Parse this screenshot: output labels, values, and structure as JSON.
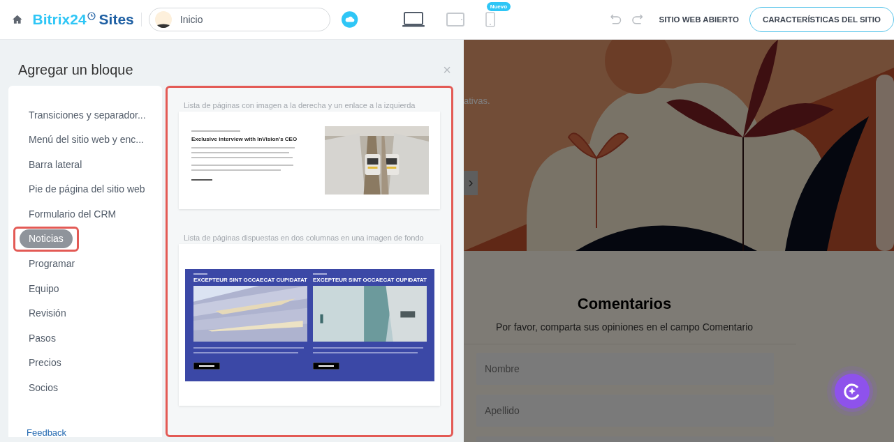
{
  "header": {
    "logo_main": "Bitrix24",
    "logo_sub": "Sites",
    "page_selector": {
      "value": "Inicio"
    },
    "devices": [
      {
        "kind": "desktop",
        "selected": true
      },
      {
        "kind": "tablet",
        "selected": false
      },
      {
        "kind": "mobile",
        "selected": false,
        "badge": "Nuevo"
      }
    ],
    "open_site": "SITIO WEB ABIERTO",
    "site_settings": "CARACTERÍSTICAS DEL SITIO"
  },
  "panel": {
    "title": "Agregar un bloque",
    "close": "×",
    "categories": [
      {
        "label": "Transiciones y separador...",
        "selected": false,
        "highlighted": false
      },
      {
        "label": "Menú del sitio web y enc...",
        "selected": false,
        "highlighted": false
      },
      {
        "label": "Barra lateral",
        "selected": false,
        "highlighted": false
      },
      {
        "label": "Pie de página del sitio web",
        "selected": false,
        "highlighted": false
      },
      {
        "label": "Formulario del CRM",
        "selected": false,
        "highlighted": false
      },
      {
        "label": "Noticias",
        "selected": true,
        "highlighted": true
      },
      {
        "label": "Programar",
        "selected": false,
        "highlighted": false
      },
      {
        "label": "Equipo",
        "selected": false,
        "highlighted": false
      },
      {
        "label": "Revisión",
        "selected": false,
        "highlighted": false
      },
      {
        "label": "Pasos",
        "selected": false,
        "highlighted": false
      },
      {
        "label": "Precios",
        "selected": false,
        "highlighted": false
      },
      {
        "label": "Socios",
        "selected": false,
        "highlighted": false
      }
    ],
    "feedback": "Feedback",
    "blocks_highlighted": true,
    "blocks": [
      {
        "kind": "article",
        "title": "Lista de páginas con imagen a la derecha y un enlace a la izquierda",
        "heading": "Exclusive interview with InVision's CEO"
      },
      {
        "kind": "columns",
        "title": "Lista de páginas dispuestas en dos columnas en una imagen de fondo",
        "columns": [
          {
            "heading": "EXCEPTEUR SINT OCCAECAT CUPIDATAT"
          },
          {
            "heading": "EXCEPTEUR SINT OCCAECAT CUPIDATAT"
          }
        ]
      }
    ]
  },
  "site": {
    "hero_text": "ativas.",
    "comments_title": "Comentarios",
    "comments_subtitle": "Por favor, comparta sus opiniones en el campo Comentario",
    "fields": [
      {
        "placeholder": "Nombre"
      },
      {
        "placeholder": "Apellido"
      }
    ]
  }
}
